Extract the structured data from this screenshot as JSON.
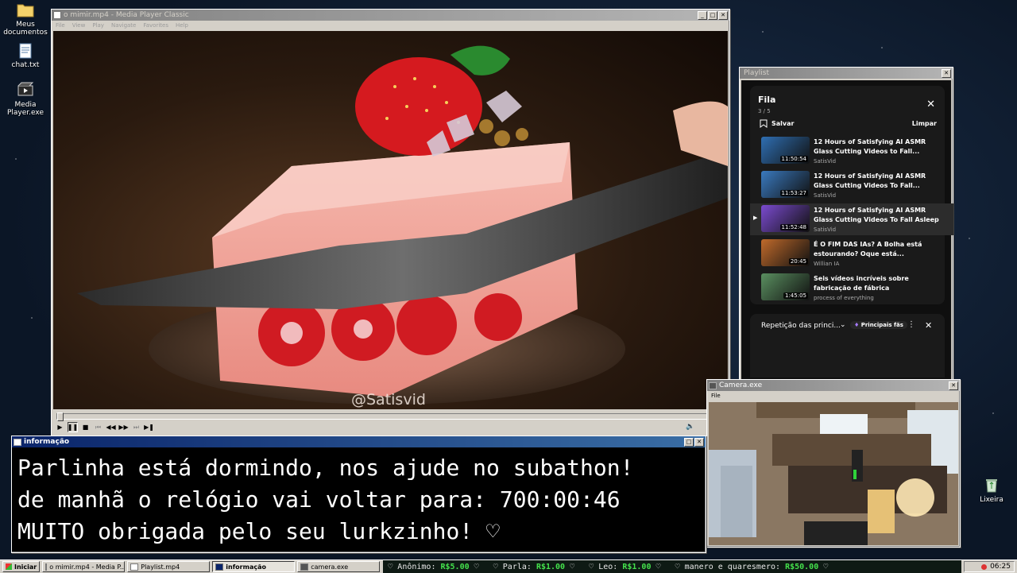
{
  "desktop_icons": [
    {
      "label": "Meus documentos",
      "icon": "folder-icon"
    },
    {
      "label": "chat.txt",
      "icon": "notepad-icon"
    },
    {
      "label": "Media Player.exe",
      "icon": "media-player-icon"
    },
    {
      "label": "Lixeira",
      "icon": "recycle-bin-icon"
    }
  ],
  "player": {
    "title": "o mimir.mp4 - Media Player Classic",
    "menu": [
      "File",
      "View",
      "Play",
      "Navigate",
      "Favorites",
      "Help"
    ],
    "watermark": "@Satisvid",
    "progress": 0.0
  },
  "playlist_window": {
    "title": "Playlist",
    "heading": "Fila",
    "position": "3 / 5",
    "save_label": "Salvar",
    "clear_label": "Limpar",
    "items": [
      {
        "title": "12 Hours of Satisfying AI ASMR Glass Cutting Videos to Fall...",
        "channel": "SatisVid",
        "duration": "11:50:54",
        "active": false
      },
      {
        "title": "12 Hours of Satisfying AI ASMR Glass Cutting Videos To Fall...",
        "channel": "SatisVid",
        "duration": "11:53:27",
        "active": false
      },
      {
        "title": "12 Hours of Satisfying AI ASMR Glass Cutting Videos To Fall Asleep To",
        "channel": "SatisVid",
        "duration": "11:52:48",
        "active": true
      },
      {
        "title": "É O FIM DAS IAs? A Bolha está estourando? Oque está...",
        "channel": "Willian IA",
        "duration": "20:45",
        "active": false
      },
      {
        "title": "Seis vídeos incríveis sobre fabricação de fábrica",
        "channel": "process of everything",
        "duration": "1:45:05",
        "active": false
      }
    ],
    "mix_label": "Repetição das princi...",
    "mix_badge": "Principais fãs"
  },
  "camera_window": {
    "title": "Camera.exe",
    "menu": [
      "File"
    ]
  },
  "info_window": {
    "title": "informação",
    "lines": [
      "Parlinha está dormindo, nos ajude no subathon!",
      "de manhã o relógio vai voltar para:  700:00:46",
      "MUITO obrigada pelo seu lurkzinho! ♡"
    ]
  },
  "taskbar": {
    "start_label": "Iniciar",
    "tasks": [
      {
        "label": "o mimir.mp4 - Media P...",
        "pressed": false
      },
      {
        "label": "Playlist.mp4",
        "pressed": false
      },
      {
        "label": "informação",
        "pressed": true
      },
      {
        "label": "camera.exe",
        "pressed": false
      }
    ],
    "ticker": [
      {
        "name": "Anônimo:",
        "amount": "R$5.00"
      },
      {
        "name": "Parla:",
        "amount": "R$1.00"
      },
      {
        "name": "Leo:",
        "amount": "R$1.00"
      },
      {
        "name": "manero e quaresmero:",
        "amount": "R$50.00"
      }
    ],
    "clock": "06:25"
  },
  "colors": {
    "accent_title": "#0a246a",
    "money": "#44e04c",
    "playlist_bg": "#1a1a1a"
  }
}
